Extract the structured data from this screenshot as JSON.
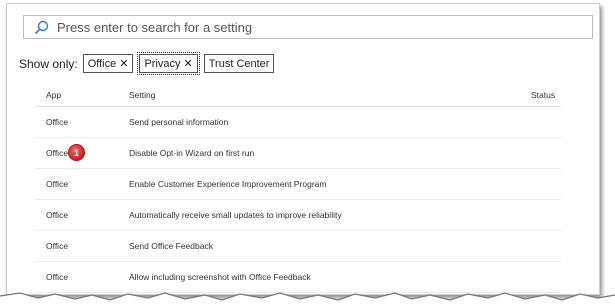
{
  "search": {
    "placeholder": "Press enter to search for a setting"
  },
  "filters": {
    "label": "Show only:",
    "chips": [
      {
        "label": "Office",
        "removable": true,
        "selected": false
      },
      {
        "label": "Privacy",
        "removable": true,
        "selected": true
      },
      {
        "label": "Trust Center",
        "removable": false,
        "selected": false
      }
    ],
    "remove_glyph": "✕"
  },
  "table": {
    "headers": {
      "app": "App",
      "setting": "Setting",
      "status": "Status"
    },
    "rows": [
      {
        "app": "Office",
        "setting": "Send personal information",
        "status": ""
      },
      {
        "app": "Office",
        "setting": "Disable Opt-in Wizard on first run",
        "status": "",
        "badge": "1"
      },
      {
        "app": "Office",
        "setting": "Enable Customer Experience Improvement Program",
        "status": ""
      },
      {
        "app": "Office",
        "setting": "Automatically receive small updates to improve reliability",
        "status": ""
      },
      {
        "app": "Office",
        "setting": "Send Office Feedback",
        "status": ""
      },
      {
        "app": "Office",
        "setting": "Allow including screenshot with Office Feedback",
        "status": ""
      }
    ]
  },
  "colors": {
    "accent": "#2b7cd3",
    "badge": "#d11f1f"
  }
}
